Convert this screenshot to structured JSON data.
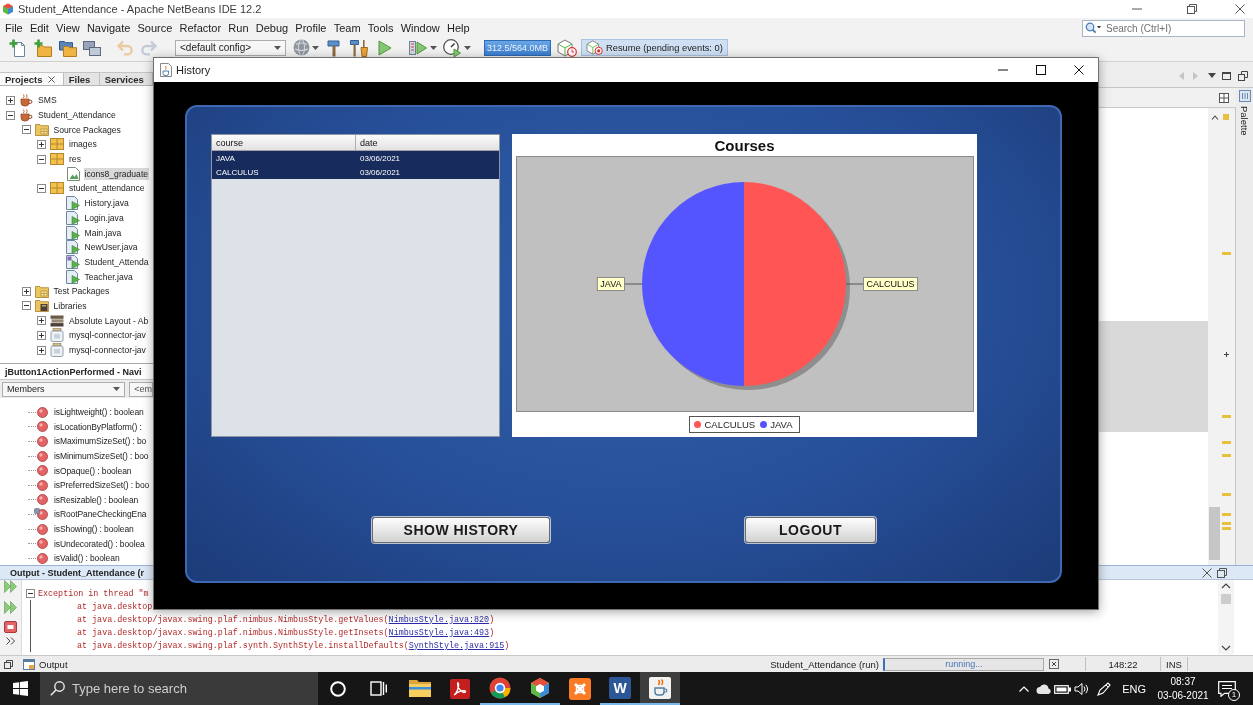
{
  "ide": {
    "title": "Student_Attendance - Apache NetBeans IDE 12.2",
    "menu": [
      "File",
      "Edit",
      "View",
      "Navigate",
      "Source",
      "Refactor",
      "Run",
      "Debug",
      "Profile",
      "Team",
      "Tools",
      "Window",
      "Help"
    ],
    "search": {
      "placeholder": "Search (Ctrl+I)"
    },
    "toolbar": {
      "buttons": [
        {
          "kind": "new-file",
          "disabled": false
        },
        {
          "kind": "new-project",
          "disabled": false
        },
        {
          "kind": "open-project",
          "disabled": false
        },
        {
          "kind": "close-project",
          "disabled": false
        },
        {
          "kind": "undo",
          "disabled": true
        },
        {
          "kind": "redo",
          "disabled": true
        }
      ],
      "config": "<default config>",
      "memory": "312.5/564.0MB",
      "resume": "Resume (pending events: 0)"
    }
  },
  "projects_panel": {
    "tabs": [
      {
        "label": "Projects",
        "selected": true
      },
      {
        "label": "Files",
        "selected": false
      },
      {
        "label": "Services",
        "selected": false
      }
    ],
    "tree": [
      {
        "label": "SMS",
        "kind": "project",
        "expanded": false,
        "selected": false
      },
      {
        "label": "Student_Attendance",
        "kind": "project",
        "expanded": true,
        "selected": false,
        "children": [
          {
            "label": "Source Packages",
            "kind": "source-folder",
            "expanded": true,
            "selected": false,
            "children": [
              {
                "label": "images",
                "kind": "package",
                "expanded": false,
                "selected": false
              },
              {
                "label": "res",
                "kind": "package",
                "expanded": true,
                "selected": false,
                "children": [
                  {
                    "label": "icons8_graduate",
                    "kind": "image-file",
                    "selected": true
                  }
                ]
              },
              {
                "label": "student_attendance",
                "kind": "package",
                "expanded": true,
                "selected": false,
                "children": [
                  {
                    "label": "History.java",
                    "kind": "java-form",
                    "selected": false
                  },
                  {
                    "label": "Login.java",
                    "kind": "java-form",
                    "selected": false
                  },
                  {
                    "label": "Main.java",
                    "kind": "java-form",
                    "selected": false
                  },
                  {
                    "label": "NewUser.java",
                    "kind": "java-form",
                    "selected": false
                  },
                  {
                    "label": "Student_Attenda",
                    "kind": "java-main",
                    "selected": false
                  },
                  {
                    "label": "Teacher.java",
                    "kind": "java-form",
                    "selected": false
                  }
                ]
              }
            ]
          },
          {
            "label": "Test Packages",
            "kind": "test-folder",
            "expanded": false,
            "selected": false
          },
          {
            "label": "Libraries",
            "kind": "libraries",
            "expanded": true,
            "selected": false,
            "children": [
              {
                "label": "Absolute Layout - Ab",
                "kind": "library",
                "expanded": false,
                "selected": false
              },
              {
                "label": "mysql-connector-jav",
                "kind": "jar",
                "expanded": false,
                "selected": false
              },
              {
                "label": "mysql-connector-jav",
                "kind": "jar",
                "expanded": false,
                "selected": false
              }
            ]
          }
        ]
      }
    ]
  },
  "navigator": {
    "title": "jButton1ActionPerformed - Navi",
    "members_filter": "Members",
    "combo_2": "<em",
    "members": [
      {
        "label": "isLightweight() : boolean",
        "kind": "method"
      },
      {
        "label": "isLocationByPlatform() :",
        "kind": "method"
      },
      {
        "label": "isMaximumSizeSet() : bo",
        "kind": "method"
      },
      {
        "label": "isMinimumSizeSet() : boo",
        "kind": "method"
      },
      {
        "label": "isOpaque() : boolean",
        "kind": "method"
      },
      {
        "label": "isPreferredSizeSet() : boo",
        "kind": "method"
      },
      {
        "label": "isResizable() : boolean",
        "kind": "method"
      },
      {
        "label": "isRootPaneCheckingEna",
        "kind": "override"
      },
      {
        "label": "isShowing() : boolean",
        "kind": "method"
      },
      {
        "label": "isUndecorated() : boolea",
        "kind": "method"
      },
      {
        "label": "isValid() : boolean",
        "kind": "method"
      }
    ]
  },
  "palette": {
    "label": "Palette"
  },
  "output": {
    "title": "Output - Student_Attendance (r",
    "lines": [
      {
        "kind": "fold",
        "text": "Exception in thread \"m",
        "expanded": true
      },
      {
        "kind": "stack",
        "text": "at java.desktop"
      },
      {
        "kind": "stack",
        "text": "at java.desktop/javax.swing.plaf.nimbus.NimbusStyle.getValues(",
        "link": "NimbusStyle.java:820",
        "tail": ")"
      },
      {
        "kind": "stack",
        "text": "at java.desktop/javax.swing.plaf.nimbus.NimbusStyle.getInsets(",
        "link": "NimbusStyle.java:493",
        "tail": ")"
      },
      {
        "kind": "stack",
        "text": "at java.desktop/javax.swing.plaf.synth.SynthStyle.installDefaults(",
        "link": "SynthStyle.java:915",
        "tail": ")"
      }
    ]
  },
  "status_bar": {
    "tab": "Output",
    "task": "Student_Attendance (run)",
    "progress": "running...",
    "position": "148:22",
    "mode": "INS"
  },
  "history_window": {
    "title": "History",
    "table": {
      "columns": [
        "course",
        "date"
      ],
      "rows": [
        {
          "cells": [
            "JAVA",
            "03/06/2021"
          ],
          "selected": true
        },
        {
          "cells": [
            "CALCULUS",
            "03/06/2021"
          ],
          "selected": true
        }
      ]
    },
    "chart_data": {
      "type": "pie",
      "title": "Courses",
      "categories": [
        "CALCULUS",
        "JAVA"
      ],
      "values": [
        50,
        50
      ],
      "colors": [
        "#ff5555",
        "#5555ff"
      ],
      "legend": "bottom"
    },
    "buttons": [
      "SHOW HISTORY",
      "LOGOUT"
    ]
  },
  "taskbar": {
    "search": {
      "placeholder": "Type here to search"
    },
    "apps": [
      {
        "kind": "folder",
        "running": false,
        "selected": false
      },
      {
        "kind": "pdf",
        "running": false,
        "selected": false
      },
      {
        "kind": "browser",
        "running": true,
        "selected": false
      },
      {
        "kind": "cube",
        "running": true,
        "selected": false
      },
      {
        "kind": "tile",
        "running": false,
        "selected": false
      },
      {
        "kind": "word",
        "label": "W",
        "running": true,
        "selected": false
      },
      {
        "kind": "cup",
        "running": true,
        "selected": true
      }
    ],
    "language": "ENG",
    "time": "08:37",
    "date": "03-06-2021",
    "notifications": "1"
  }
}
